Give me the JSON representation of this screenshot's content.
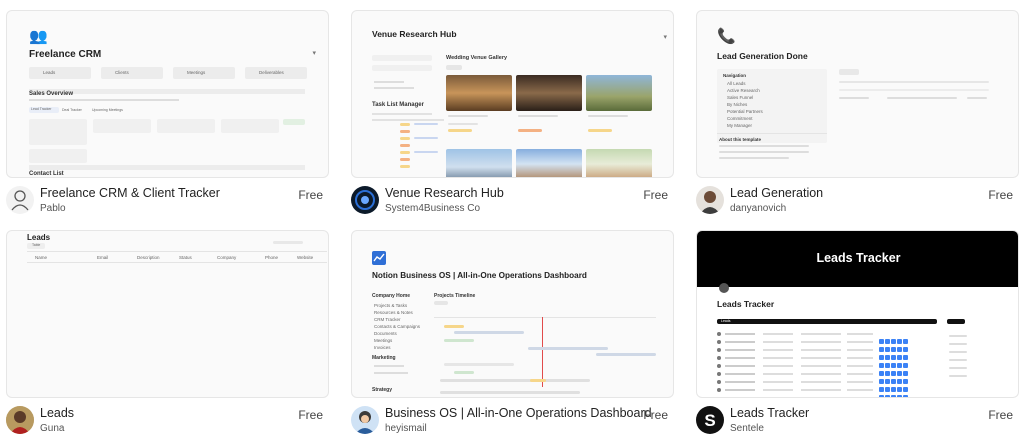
{
  "templates": [
    {
      "title": "Freelance CRM & Client Tracker",
      "author": "Pablo",
      "price": "Free",
      "preview": {
        "heading": "Freelance CRM",
        "icon": "people-icon",
        "nav": [
          "Leads",
          "Clients",
          "Meetings",
          "Deliverables"
        ],
        "section1": "Sales Overview",
        "section2": "Contact List",
        "tabs": [
          "Lead Tracker",
          "Deal Tracker",
          "Upcoming Meetings"
        ]
      }
    },
    {
      "title": "Venue Research Hub",
      "author": "System4Business Co",
      "price": "Free",
      "preview": {
        "heading": "Venue Research Hub",
        "gallery": "Wedding Venue Gallery",
        "task": "Task List Manager"
      }
    },
    {
      "title": "Lead Generation",
      "author": "danyanovich",
      "price": "Free",
      "preview": {
        "heading": "Lead Generation Done",
        "icon": "phone-icon",
        "nav_label": "Navigation",
        "nav": [
          "All Leads",
          "Active Research",
          "Sales Funnel",
          "By Niches",
          "Potential Partners",
          "Commitment",
          "My Manager"
        ],
        "about": "About this template"
      }
    },
    {
      "title": "Leads",
      "author": "Guna",
      "price": "Free",
      "preview": {
        "heading": "Leads",
        "tab": "Table",
        "cols": [
          "Name",
          "Email",
          "Description",
          "Status",
          "Company",
          "Phone",
          "Website"
        ]
      }
    },
    {
      "title": "Business OS | All-in-One Operations Dashboard",
      "author": "heyismail",
      "price": "Free",
      "preview": {
        "heading": "Notion Business OS | All-in-One Operations Dashboard",
        "icon": "chart-icon",
        "side_title": "Company Home",
        "side": [
          "Projects & Tasks",
          "Resources & Notes",
          "CRM Tracker",
          "Contacts & Campaigns",
          "Documents",
          "Meetings",
          "Invoices"
        ],
        "marketing": "Marketing",
        "strategy": "Strategy",
        "timeline": "Projects Timeline"
      }
    },
    {
      "title": "Leads Tracker",
      "author": "Sentele",
      "price": "Free",
      "preview": {
        "banner": "Leads Tracker",
        "heading": "Leads Tracker",
        "table": "Leads"
      }
    }
  ]
}
